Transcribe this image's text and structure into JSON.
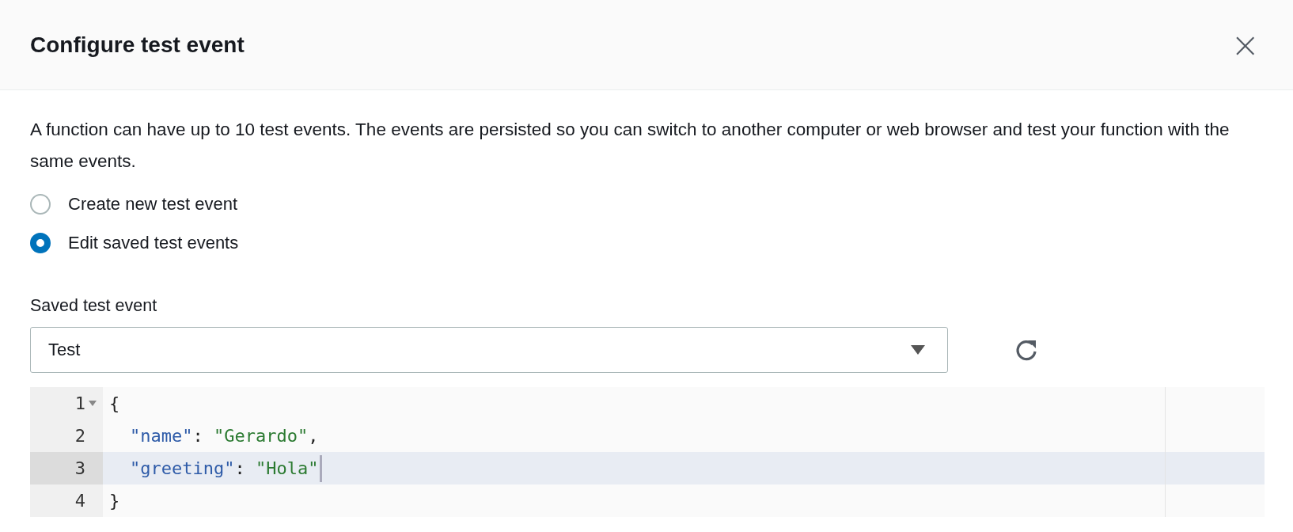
{
  "dialog": {
    "title": "Configure test event",
    "close": "×"
  },
  "description": "A function can have up to 10 test events. The events are persisted so you can switch to another computer or web browser and test your function with the same events.",
  "options": [
    {
      "label": "Create new test event",
      "selected": false
    },
    {
      "label": "Edit saved test events",
      "selected": true
    }
  ],
  "saved_event": {
    "label": "Saved test event",
    "value": "Test"
  },
  "editor": {
    "lines": [
      {
        "number": "1",
        "foldable": true,
        "indented": false,
        "active": false,
        "tokens": [
          {
            "kind": "punct",
            "text": "{"
          }
        ]
      },
      {
        "number": "2",
        "foldable": false,
        "indented": true,
        "active": false,
        "tokens": [
          {
            "kind": "key",
            "text": "\"name\""
          },
          {
            "kind": "punct",
            "text": ": "
          },
          {
            "kind": "string",
            "text": "\"Gerardo\""
          },
          {
            "kind": "punct",
            "text": ","
          }
        ]
      },
      {
        "number": "3",
        "foldable": false,
        "indented": true,
        "active": true,
        "tokens": [
          {
            "kind": "key",
            "text": "\"greeting\""
          },
          {
            "kind": "punct",
            "text": ": "
          },
          {
            "kind": "string",
            "text": "\"Hola\""
          }
        ]
      },
      {
        "number": "4",
        "foldable": false,
        "indented": false,
        "active": false,
        "tokens": [
          {
            "kind": "punct",
            "text": "}"
          }
        ]
      }
    ]
  }
}
